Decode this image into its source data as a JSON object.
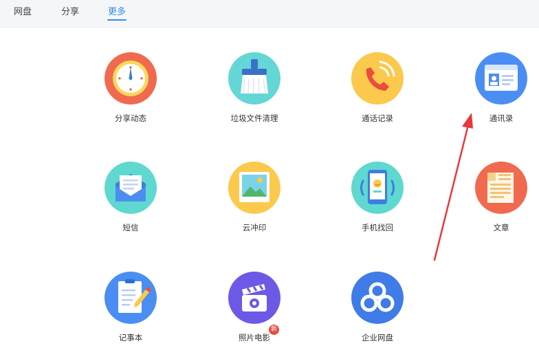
{
  "tabs": [
    {
      "label": "网盘"
    },
    {
      "label": "分享"
    },
    {
      "label": "更多"
    }
  ],
  "active_tab": "更多",
  "apps": [
    {
      "label": "分享动态",
      "icon": "clock-icon"
    },
    {
      "label": "垃圾文件清理",
      "icon": "broom-icon"
    },
    {
      "label": "通话记录",
      "icon": "phone-icon"
    },
    {
      "label": "通讯录",
      "icon": "contact-card-icon"
    },
    {
      "label": "短信",
      "icon": "envelope-icon"
    },
    {
      "label": "云冲印",
      "icon": "photo-print-icon"
    },
    {
      "label": "手机找回",
      "icon": "find-phone-icon"
    },
    {
      "label": "文章",
      "icon": "article-icon"
    },
    {
      "label": "记事本",
      "icon": "notepad-icon"
    },
    {
      "label": "照片电影",
      "icon": "film-clapper-icon",
      "badge": "新"
    },
    {
      "label": "企业网盘",
      "icon": "cloud-icon"
    }
  ],
  "colors": {
    "accent": "#2e8cf0",
    "arrow": "#e8373a"
  }
}
